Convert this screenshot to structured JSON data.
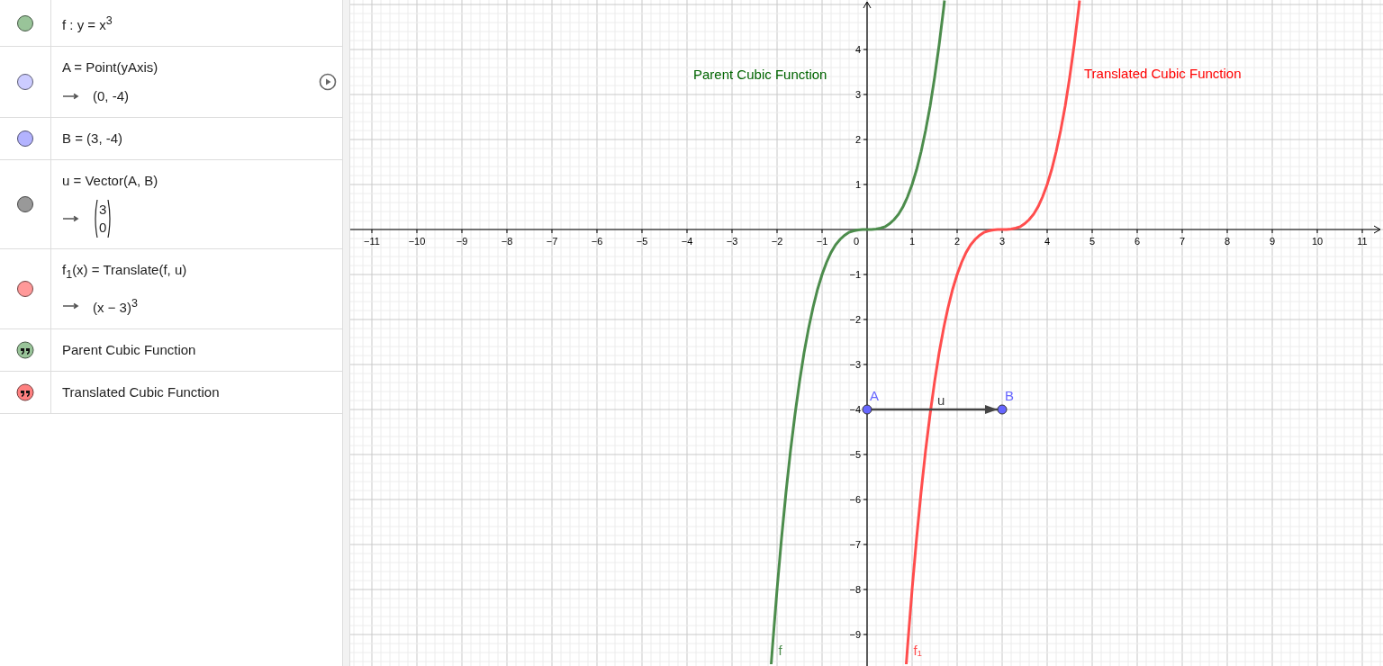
{
  "algebra": {
    "items": [
      {
        "kind": "object",
        "color": "#99c499",
        "definition": "f : y = x$^{3}$",
        "play_button": false
      },
      {
        "kind": "object",
        "color": "#ccccff",
        "definition": "A = Point(yAxis)",
        "output": "(0, -4)",
        "play_button": true
      },
      {
        "kind": "object",
        "color": "#b3b3ff",
        "definition": "B = (3, -4)",
        "play_button": false
      },
      {
        "kind": "object",
        "color": "#999999",
        "definition": "u = Vector(A, B)",
        "output_vector": [
          "3",
          "0"
        ],
        "play_button": false
      },
      {
        "kind": "object",
        "color": "#ff9999",
        "definition": "f$_{1}$(x) = Translate(f, u)",
        "output": "(x − 3)$^{3}$",
        "play_button": false
      },
      {
        "kind": "text",
        "color": "#99c499",
        "definition": "Parent Cubic Function",
        "play_button": false
      },
      {
        "kind": "text",
        "color": "#ff8080",
        "definition": "Translated Cubic Function",
        "play_button": false
      }
    ]
  },
  "graphics": {
    "labels": [
      {
        "text": "Parent Cubic Function",
        "color": "#006400"
      },
      {
        "text": "Translated Cubic Function",
        "color": "#ff0000"
      }
    ],
    "origin_label": "0",
    "chart_data": {
      "type": "line",
      "x": [
        -2.13,
        -2.1,
        -2.0,
        -1.9,
        -1.8,
        -1.7,
        -1.6,
        -1.5,
        -1.4,
        -1.3,
        -1.2,
        -1.1,
        -1.0,
        -0.9,
        -0.8,
        -0.7,
        -0.6,
        -0.5,
        -0.4,
        -0.3,
        -0.2,
        -0.1,
        0,
        0.1,
        0.2,
        0.3,
        0.4,
        0.5,
        0.6,
        0.7,
        0.8,
        0.87,
        0.9,
        1.0,
        1.1,
        1.2,
        1.3,
        1.4,
        1.5,
        1.6,
        1.7,
        1.72,
        1.8,
        1.9,
        2.0,
        2.1,
        2.2,
        2.3,
        2.4,
        2.5,
        2.6,
        2.7,
        2.8,
        2.9,
        3.0,
        3.1,
        3.2,
        3.3,
        3.4,
        3.5,
        3.6,
        3.7,
        3.8,
        3.9,
        4.0,
        4.1,
        4.2,
        4.3,
        4.4,
        4.5,
        4.6,
        4.7,
        4.72
      ],
      "series": [
        {
          "name": "f",
          "color": "#4c8c4c",
          "values": [
            -9.66,
            -9.26,
            -8,
            -6.86,
            -5.83,
            -4.91,
            -4.1,
            -3.38,
            -2.74,
            -2.2,
            -1.73,
            -1.33,
            -1,
            -0.73,
            -0.51,
            -0.34,
            -0.22,
            -0.13,
            -0.06,
            -0.03,
            -0.01,
            0,
            0,
            0,
            0.01,
            0.03,
            0.06,
            0.13,
            0.22,
            0.34,
            0.51,
            0.66,
            0.73,
            1,
            1.33,
            1.73,
            2.2,
            2.74,
            3.38,
            4.1,
            4.91,
            5.09,
            null,
            null,
            null,
            null,
            null,
            null,
            null,
            null,
            null,
            null,
            null,
            null,
            null,
            null,
            null,
            null,
            null,
            null,
            null,
            null,
            null,
            null,
            null,
            null,
            null,
            null,
            null,
            null,
            null,
            null,
            null
          ]
        },
        {
          "name": "f₁",
          "color": "#ff4d4d",
          "values": [
            null,
            null,
            null,
            null,
            null,
            null,
            null,
            null,
            null,
            null,
            null,
            null,
            null,
            null,
            null,
            null,
            null,
            null,
            null,
            null,
            null,
            null,
            null,
            null,
            null,
            null,
            null,
            null,
            null,
            null,
            null,
            -9.66,
            -9.26,
            -8,
            -6.86,
            -5.83,
            -4.91,
            -4.1,
            -3.38,
            -2.74,
            -2.2,
            -2.1,
            -1.73,
            -1.33,
            -1,
            -0.73,
            -0.51,
            -0.34,
            -0.22,
            -0.13,
            -0.06,
            -0.03,
            -0.01,
            0,
            0,
            0,
            0.01,
            0.03,
            0.06,
            0.13,
            0.22,
            0.34,
            0.51,
            0.73,
            1,
            1.33,
            1.73,
            2.2,
            2.74,
            3.38,
            4.1,
            4.91,
            5.09
          ]
        },
        {
          "name": "u",
          "color": "#444444",
          "values": [
            null,
            null,
            null,
            null,
            null,
            null,
            null,
            null,
            null,
            null,
            null,
            null,
            null,
            null,
            null,
            null,
            null,
            null,
            null,
            null,
            null,
            null,
            -4,
            -4,
            -4,
            -4,
            -4,
            -4,
            -4,
            -4,
            -4,
            -4,
            -4,
            -4,
            -4,
            -4,
            -4,
            -4,
            -4,
            -4,
            -4,
            -4,
            -4,
            -4,
            -4,
            -4,
            -4,
            -4,
            -4,
            -4,
            -4,
            -4,
            -4,
            -4,
            -4,
            null,
            null,
            null,
            null,
            null,
            null,
            null,
            null,
            null,
            null,
            null,
            null,
            null,
            null,
            null,
            null,
            null,
            null
          ]
        }
      ],
      "grid": true,
      "xlim": [
        -11.48,
        11.46
      ],
      "ylim": [
        -9.7,
        5.1
      ],
      "xticks": [
        {
          "value": -11,
          "label": "−11"
        },
        {
          "value": -10,
          "label": "−10"
        },
        {
          "value": -9,
          "label": "−9"
        },
        {
          "value": -8,
          "label": "−8"
        },
        {
          "value": -7,
          "label": "−7"
        },
        {
          "value": -6,
          "label": "−6"
        },
        {
          "value": -5,
          "label": "−5"
        },
        {
          "value": -4,
          "label": "−4"
        },
        {
          "value": -3,
          "label": "−3"
        },
        {
          "value": -2,
          "label": "−2"
        },
        {
          "value": -1,
          "label": "−1"
        },
        1,
        2,
        3,
        4,
        5,
        6,
        7,
        8,
        9,
        10,
        11
      ],
      "yticks": [
        4,
        3,
        2,
        1,
        {
          "value": -1,
          "label": "−1"
        },
        {
          "value": -2,
          "label": "−2"
        },
        {
          "value": -3,
          "label": "−3"
        },
        {
          "value": -4,
          "label": "−4"
        },
        {
          "value": -5,
          "label": "−5"
        },
        {
          "value": -6,
          "label": "−6"
        },
        {
          "value": -7,
          "label": "−7"
        },
        {
          "value": -8,
          "label": "−8"
        },
        {
          "value": -9,
          "label": "−9"
        }
      ],
      "annotations": [
        {
          "text": "A",
          "x": 0,
          "y": -4
        },
        {
          "text": "B",
          "x": 3,
          "y": -4
        }
      ]
    }
  }
}
